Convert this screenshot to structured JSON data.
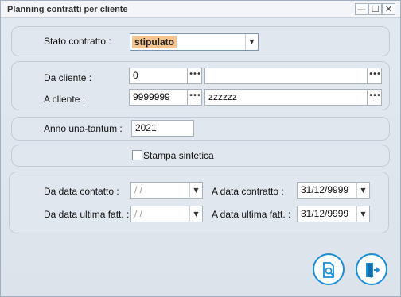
{
  "window": {
    "title": "Planning contratti per cliente"
  },
  "window_controls": {
    "minimize": "—",
    "maximize": "☐",
    "close": "✕"
  },
  "stato": {
    "label": "Stato contratto :",
    "value": "stipulato"
  },
  "clienti": {
    "da_label": "Da cliente :",
    "da_code": "0",
    "da_name": "",
    "a_label": "A cliente :",
    "a_code": "9999999",
    "a_name": "zzzzzz",
    "lookup": "•••"
  },
  "anno": {
    "label": "Anno una-tantum :",
    "value": "2021"
  },
  "stampa": {
    "label": "Stampa sintetica",
    "checked": false
  },
  "date": {
    "da_contatto_label": "Da data contatto :",
    "da_contatto_value": " /  /",
    "a_contratto_label": "A data contratto :",
    "a_contratto_value": "31/12/9999",
    "da_ultima_label": "Da data ultima fatt. :",
    "da_ultima_value": " /  /",
    "a_ultima_label": "A data ultima fatt. :",
    "a_ultima_value": "31/12/9999",
    "dropdown_glyph": "▼"
  },
  "colors": {
    "accent": "#1a8fd6",
    "highlight": "#f5c38e"
  }
}
